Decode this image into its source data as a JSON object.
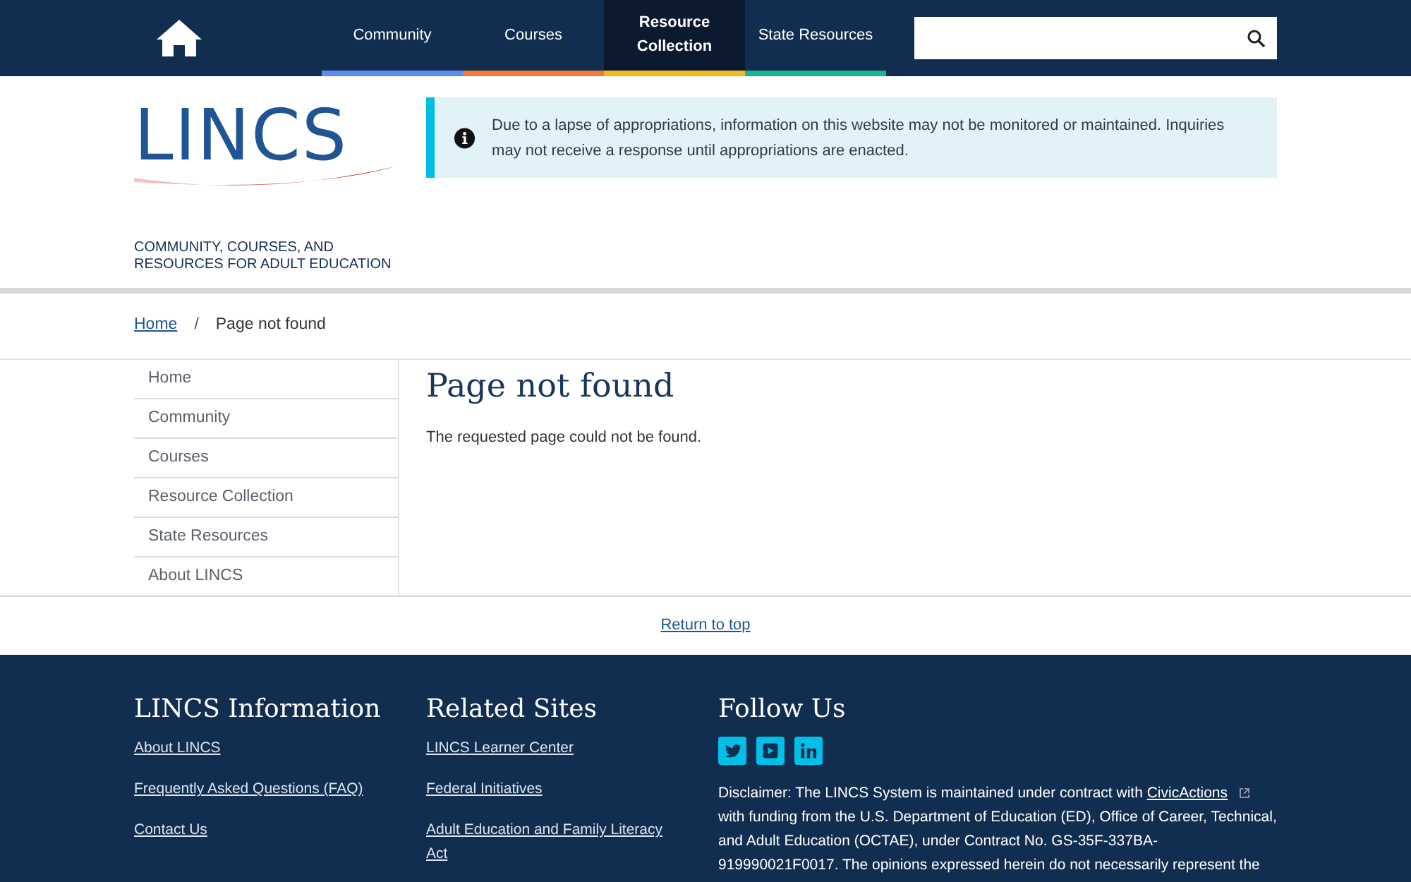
{
  "header": {
    "tabs": [
      {
        "label": "Community",
        "selected": false,
        "color": "#5b8def"
      },
      {
        "label": "Courses",
        "selected": false,
        "color": "#f07a3a"
      },
      {
        "label": "Resource Collection",
        "selected": true,
        "color": "#f5b921"
      },
      {
        "label": "State Resources",
        "selected": false,
        "color": "#1ab394"
      }
    ]
  },
  "logo": {
    "text": "LINCS",
    "tagline": [
      "COMMUNITY, COURSES, AND",
      "RESOURCES FOR ADULT EDUCATION"
    ]
  },
  "alert": {
    "text": "Due to a lapse of appropriations, information on this website may not be monitored or maintained. Inquiries may not receive a response until appropriations are enacted."
  },
  "breadcrumb": {
    "link": "Home",
    "separator": "/",
    "current": "Page not found"
  },
  "sidebar": {
    "items": [
      "Home",
      "Community",
      "Courses",
      "Resource Collection",
      "State Resources",
      "About LINCS"
    ]
  },
  "main": {
    "title": "Page not found",
    "body": "The requested page could not be found."
  },
  "return_to_top": "Return to top",
  "footer": {
    "columns": [
      {
        "title": "LINCS Information",
        "links": [
          "About LINCS",
          "Frequently Asked Questions (FAQ)",
          "Contact Us"
        ]
      },
      {
        "title": "Related Sites",
        "links": [
          "LINCS Learner Center",
          "Federal Initiatives",
          "Adult Education and Family Literacy Act"
        ]
      }
    ],
    "follow": {
      "title": "Follow Us",
      "disclaimer_before": "Disclaimer: The LINCS System is maintained under contract with",
      "disclaimer_link": "CivicActions",
      "disclaimer_after": "with funding from the U.S. Department of Education (ED), Office of Career, Technical, and Adult Education (OCTAE), under Contract No. GS-35F-337BA-919990021F0017. The opinions expressed herein do not necessarily represent the"
    }
  }
}
